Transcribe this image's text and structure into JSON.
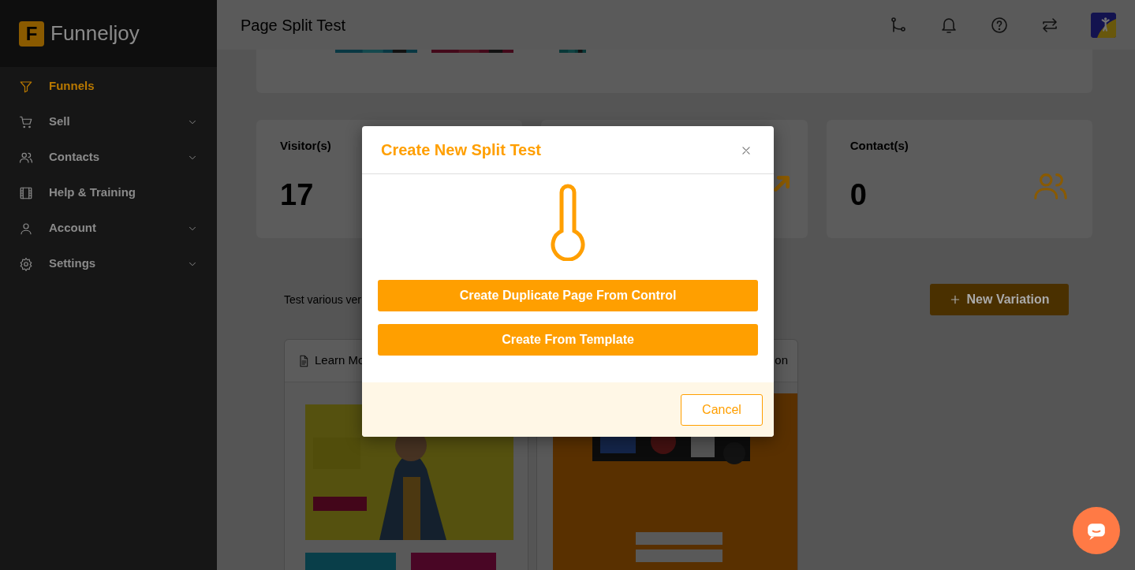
{
  "app": {
    "logo_letter": "F",
    "name": "Funneljoy"
  },
  "sidebar": {
    "items": [
      {
        "label": "Funnels",
        "selected": true,
        "expandable": false
      },
      {
        "label": "Sell",
        "selected": false,
        "expandable": true
      },
      {
        "label": "Contacts",
        "selected": false,
        "expandable": true
      },
      {
        "label": "Help & Training",
        "selected": false,
        "expandable": false
      },
      {
        "label": "Account",
        "selected": false,
        "expandable": true
      },
      {
        "label": "Settings",
        "selected": false,
        "expandable": true
      }
    ]
  },
  "header": {
    "title": "Page Split Test"
  },
  "stats": [
    {
      "label": "Visitor(s)",
      "value": "17"
    },
    {
      "label": "Contact(s)",
      "value": "0"
    }
  ],
  "variations": {
    "description": "Test various ver",
    "new_button": "New Variation",
    "cards": [
      {
        "title": "Learn Mo"
      },
      {
        "title": "on"
      }
    ]
  },
  "modal": {
    "title": "Create New Split Test",
    "buttons": [
      "Create Duplicate Page From Control",
      "Create From Template"
    ],
    "cancel": "Cancel"
  }
}
